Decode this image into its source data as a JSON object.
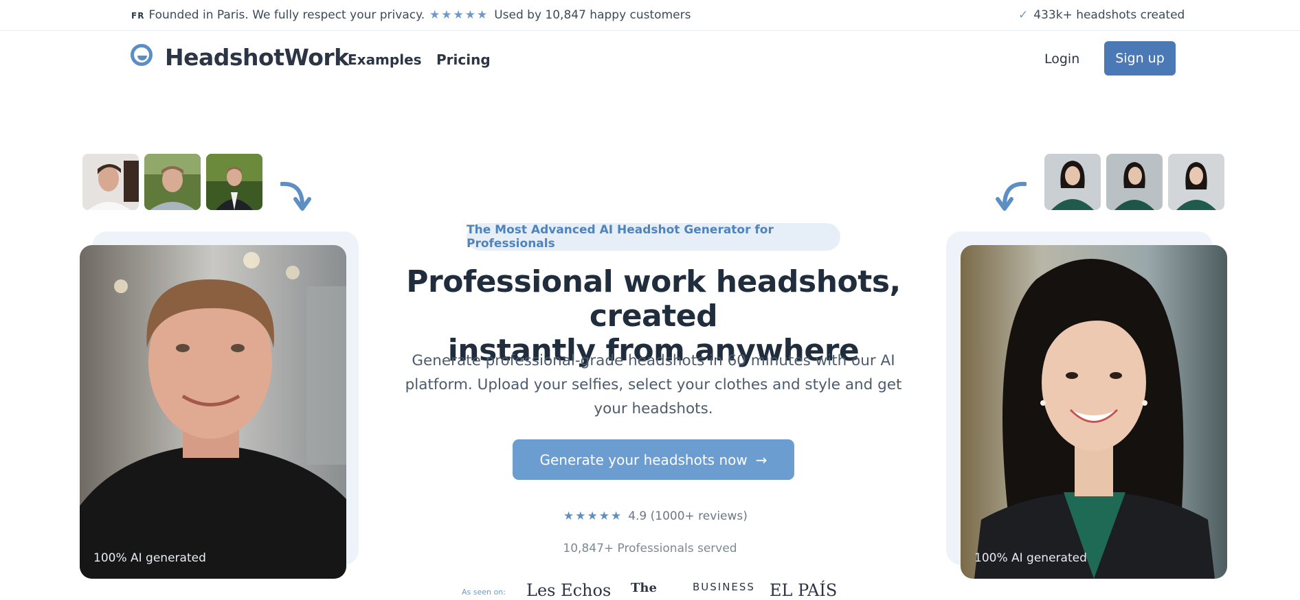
{
  "topbar": {
    "fr_tag": "FR",
    "founded": "Founded in Paris. We fully respect your privacy.",
    "stars": "★★★★★",
    "customers": "Used by 10,847 happy customers",
    "check": "✓",
    "created": "433k+ headshots created"
  },
  "nav": {
    "brand": "HeadshotWork",
    "examples": "Examples",
    "pricing": "Pricing",
    "login": "Login",
    "signup": "Sign up"
  },
  "hero": {
    "badge": "The Most Advanced AI Headshot Generator for Professionals",
    "headline_line1": "Professional work headshots, created",
    "headline_line2": "instantly from anywhere",
    "subtitle": "Generate professional-grade headshots in 60 minutes with our AI platform. Upload your selfies, select your clothes and style and get your headshots.",
    "cta": "Generate your headshots now",
    "cta_arrow": "→",
    "rating_stars": "★★★★★",
    "rating": "4.9 (1000+ reviews)",
    "served": "10,847+ Professionals served",
    "left_caption": "100% AI generated",
    "right_caption": "100% AI generated"
  },
  "press": {
    "as_seen_on": "As seen on:",
    "logos": [
      "Les Echos",
      "The",
      "BUSINESS",
      "EL PAÍS"
    ]
  },
  "colors": {
    "accent": "#4a79b5",
    "cta": "#6c9dd0",
    "badge_bg": "#e6eff8"
  }
}
